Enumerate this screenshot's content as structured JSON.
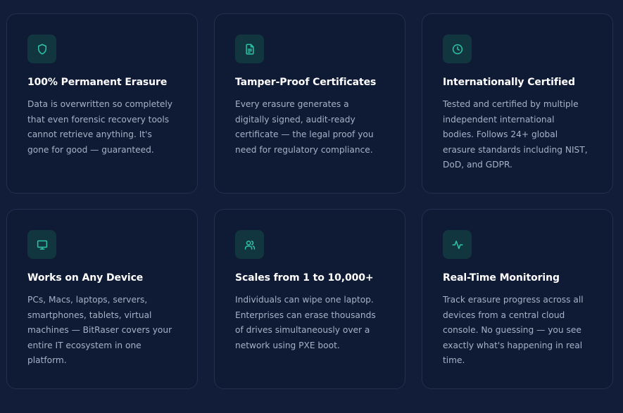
{
  "colors": {
    "page_background": "#111d39",
    "card_background": "#0f1b35",
    "card_border": "#22304e",
    "icon_background": "#12363f",
    "accent": "#2ec4a6",
    "title": "#ffffff",
    "text": "#a7b2c6"
  },
  "cards": [
    {
      "icon": "shield-icon",
      "title": "100% Permanent Erasure",
      "lines": [
        "Data is overwritten so completely",
        "that even forensic recovery tools",
        "cannot retrieve anything. It's",
        "gone for good — guaranteed."
      ]
    },
    {
      "icon": "document-icon",
      "title": "Tamper-Proof Certificates",
      "lines": [
        "Every erasure generates a",
        "digitally signed, audit-ready",
        "certificate — the legal proof you",
        "need for regulatory compliance."
      ]
    },
    {
      "icon": "clock-icon",
      "title": "Internationally Certified",
      "lines": [
        "Tested and certified by multiple",
        "independent international",
        "bodies. Follows 24+ global",
        "erasure standards including NIST,",
        "DoD, and GDPR."
      ]
    },
    {
      "icon": "monitor-icon",
      "title": "Works on Any Device",
      "lines": [
        "PCs, Macs, laptops, servers,",
        "smartphones, tablets, virtual",
        "machines — BitRaser covers your",
        "entire IT ecosystem in one",
        "platform."
      ]
    },
    {
      "icon": "users-icon",
      "title": "Scales from 1 to 10,000+",
      "lines": [
        "Individuals can wipe one laptop.",
        "Enterprises can erase thousands",
        "of drives simultaneously over a",
        "network using PXE boot."
      ]
    },
    {
      "icon": "activity-icon",
      "title": "Real-Time Monitoring",
      "lines": [
        "Track erasure progress across all",
        "devices from a central cloud",
        "console. No guessing — you see",
        "exactly what's happening in real",
        "time."
      ]
    }
  ]
}
